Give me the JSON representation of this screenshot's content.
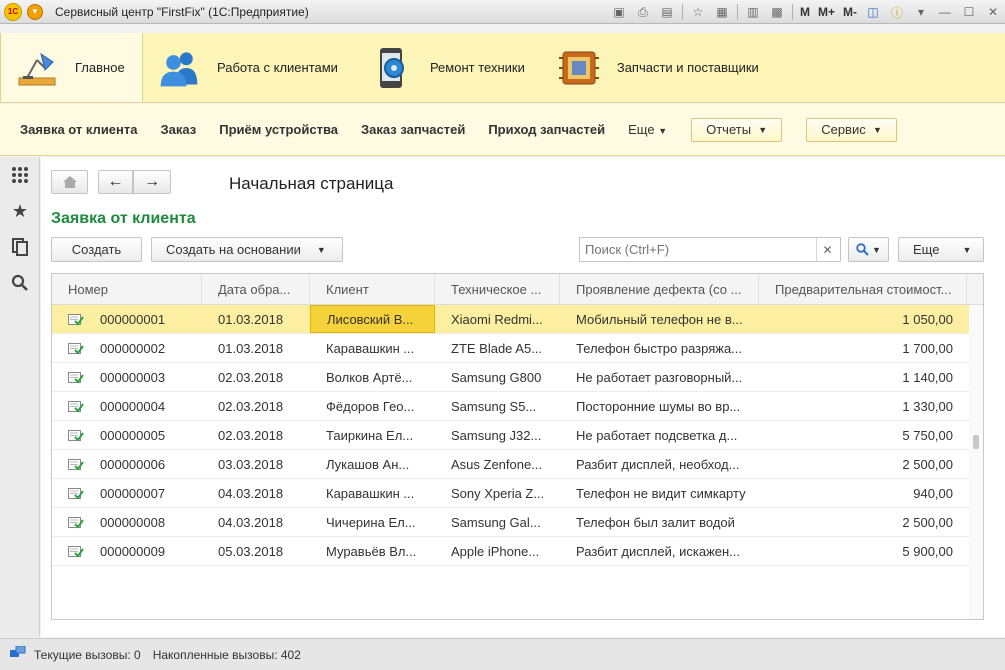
{
  "window": {
    "title": "Сервисный центр \"FirstFix\"  (1С:Предприятие)"
  },
  "titlebar_tools": {
    "m": "M",
    "mplus": "M+",
    "mminus": "M-"
  },
  "sections": [
    {
      "label": "Главное",
      "icon": "desk-lamp-icon"
    },
    {
      "label": "Работа с клиентами",
      "icon": "people-icon"
    },
    {
      "label": "Ремонт техники",
      "icon": "phone-gear-icon"
    },
    {
      "label": "Запчасти и поставщики",
      "icon": "chip-box-icon"
    }
  ],
  "functions": {
    "items": [
      "Заявка от клиента",
      "Заказ",
      "Приём устройства",
      "Заказ запчастей",
      "Приход запчастей"
    ],
    "more": "Еще",
    "reports": "Отчеты",
    "service": "Сервис"
  },
  "page": {
    "title": "Начальная страница"
  },
  "form": {
    "title": "Заявка от клиента",
    "create": "Создать",
    "create_based": "Создать на основании",
    "search_placeholder": "Поиск (Ctrl+F)",
    "more": "Еще"
  },
  "table": {
    "columns": [
      "Номер",
      "Дата обра...",
      "Клиент",
      "Техническое ...",
      "Проявление дефекта (со ...",
      "Предварительная стоимост..."
    ],
    "rows": [
      [
        "000000001",
        "01.03.2018",
        "Лисовский В...",
        "Xiaomi Redmi...",
        "Мобильный телефон не в...",
        "1 050,00"
      ],
      [
        "000000002",
        "01.03.2018",
        "Каравашкин ...",
        "ZTE Blade A5...",
        "Телефон быстро разряжа...",
        "1 700,00"
      ],
      [
        "000000003",
        "02.03.2018",
        "Волков Артё...",
        "Samsung G800",
        "Не работает разговорный...",
        "1 140,00"
      ],
      [
        "000000004",
        "02.03.2018",
        "Фёдоров Гео...",
        "Samsung S5...",
        "Посторонние шумы во вр...",
        "1 330,00"
      ],
      [
        "000000005",
        "02.03.2018",
        "Таиркина Ел...",
        "Samsung J32...",
        "Не работает подсветка д...",
        "5 750,00"
      ],
      [
        "000000006",
        "03.03.2018",
        "Лукашов Ан...",
        "Asus Zenfone...",
        "Разбит дисплей, необход...",
        "2 500,00"
      ],
      [
        "000000007",
        "04.03.2018",
        "Каравашкин ...",
        "Sony Xperia Z...",
        "Телефон не видит симкарту",
        "940,00"
      ],
      [
        "000000008",
        "04.03.2018",
        "Чичерина Ел...",
        "Samsung Gal...",
        "Телефон был залит водой",
        "2 500,00"
      ],
      [
        "000000009",
        "05.03.2018",
        "Муравьёв Вл...",
        "Apple iPhone...",
        "Разбит дисплей, искажен...",
        "5 900,00"
      ]
    ],
    "selected_row": 0
  },
  "status": {
    "current_calls": "Текущие вызовы: 0",
    "accumulated_calls": "Накопленные вызовы: 402"
  },
  "colors": {
    "section_bg": "#fdf4b8",
    "selected_row": "#fcefa1",
    "form_title": "#1e8a3c"
  }
}
